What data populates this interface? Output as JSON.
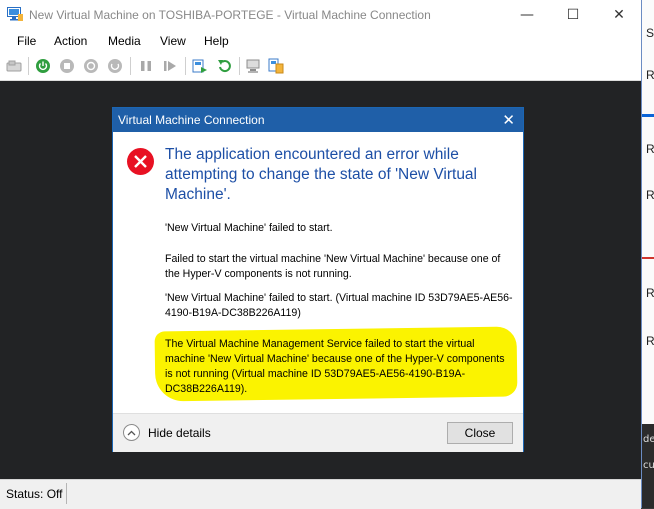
{
  "window": {
    "title": "New Virtual Machine on TOSHIBA-PORTEGE - Virtual Machine Connection",
    "minimize_glyph": "—",
    "maximize_glyph": "☐",
    "close_glyph": "✕"
  },
  "menu": [
    "File",
    "Action",
    "Media",
    "View",
    "Help"
  ],
  "toolbar": [
    "ctrl-alt-del-icon",
    "start-icon",
    "turn-off-icon",
    "shutdown-icon",
    "save-icon",
    "pause-icon",
    "reset-icon",
    "checkpoint-icon",
    "revert-icon",
    "enhanced-session-icon",
    "share-icon"
  ],
  "status": {
    "text": "Status: Off"
  },
  "background_app": {
    "letters": [
      "S",
      "R",
      "R",
      "R",
      "R",
      "R"
    ],
    "bottom_letters": [
      "de",
      "cu"
    ]
  },
  "dialog": {
    "title": "Virtual Machine Connection",
    "close_glyph": "✕",
    "main_instruction": "The application encountered an error while attempting to change the state of 'New Virtual Machine'.",
    "paragraphs": [
      "'New Virtual Machine' failed to start.",
      "Failed to start the virtual machine 'New Virtual Machine' because one of the Hyper-V components is not running.",
      "'New Virtual Machine' failed to start. (Virtual machine ID 53D79AE5-AE56-4190-B19A-DC38B226A119)",
      "The Virtual Machine Management Service failed to start the virtual machine 'New Virtual Machine' because one of the Hyper-V components is not running (Virtual machine ID 53D79AE5-AE56-4190-B19A-DC38B226A119)."
    ],
    "details_label": "Hide details",
    "close_label": "Close"
  },
  "colors": {
    "dialog_title_bg": "#1f5fa8",
    "main_instruction": "#1d4fa6",
    "highlight": "#fbf300",
    "error_icon": "#e81123",
    "vm_area": "#222325"
  }
}
